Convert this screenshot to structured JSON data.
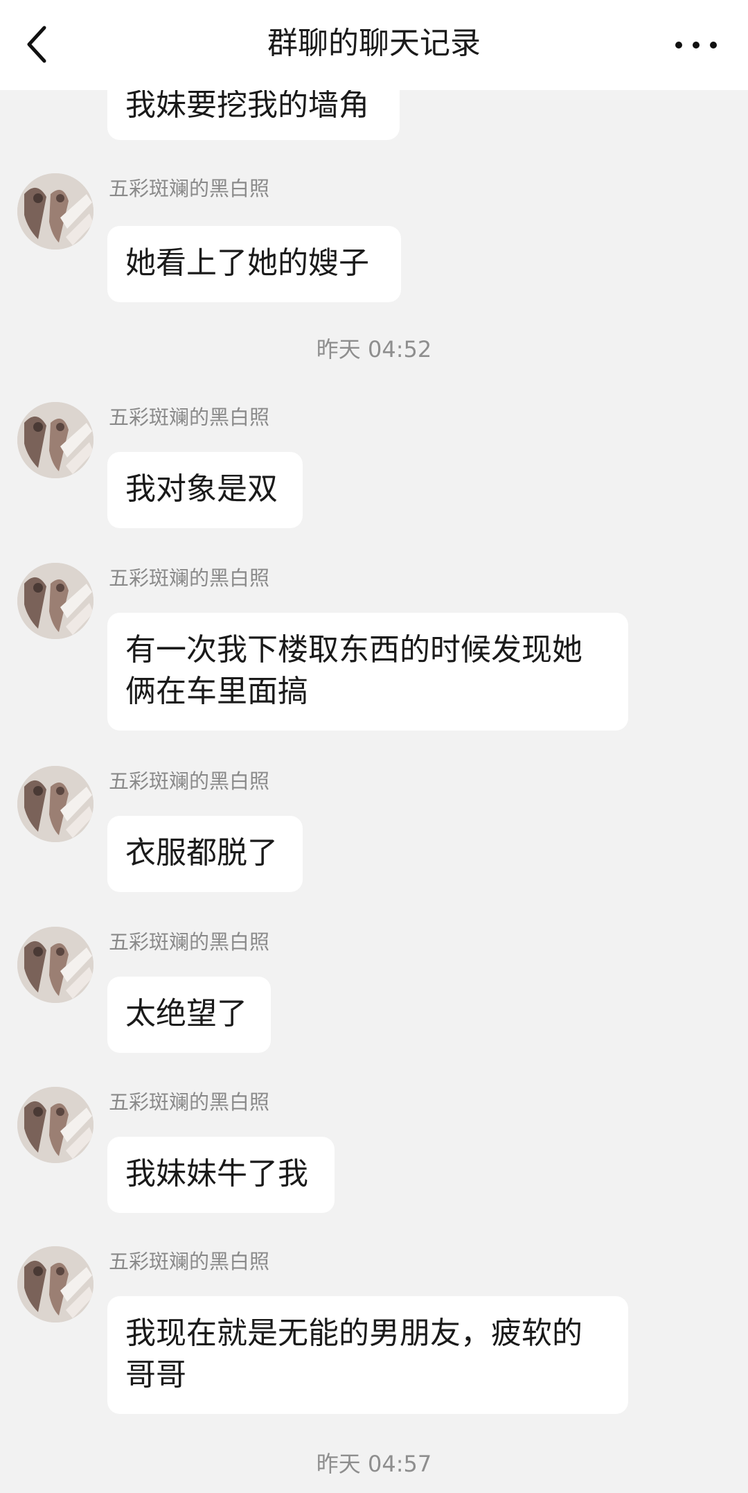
{
  "header": {
    "title": "群聊的聊天记录"
  },
  "messages": [
    {
      "sender": "",
      "text": "我妹要挖我的墙角"
    },
    {
      "sender": "五彩斑斓的黑白照",
      "text": "她看上了她的嫂子"
    },
    {
      "sender": "五彩斑斓的黑白照",
      "text": "我对象是双"
    },
    {
      "sender": "五彩斑斓的黑白照",
      "text": "有一次我下楼取东西的时候发现她俩在车里面搞"
    },
    {
      "sender": "五彩斑斓的黑白照",
      "text": "衣服都脱了"
    },
    {
      "sender": "五彩斑斓的黑白照",
      "text": "太绝望了"
    },
    {
      "sender": "五彩斑斓的黑白照",
      "text": "我妹妹牛了我"
    },
    {
      "sender": "五彩斑斓的黑白照",
      "text": "我现在就是无能的男朋友，疲软的哥哥"
    }
  ],
  "timestamps": [
    "昨天 04:52",
    "昨天 04:57"
  ],
  "icons": {
    "back": "chevron-left-icon",
    "more": "more-horizontal-icon"
  },
  "colors": {
    "background": "#f2f2f2",
    "bubble": "#ffffff",
    "sender": "#8a8a8a",
    "timestamp": "#8e8e8e"
  }
}
